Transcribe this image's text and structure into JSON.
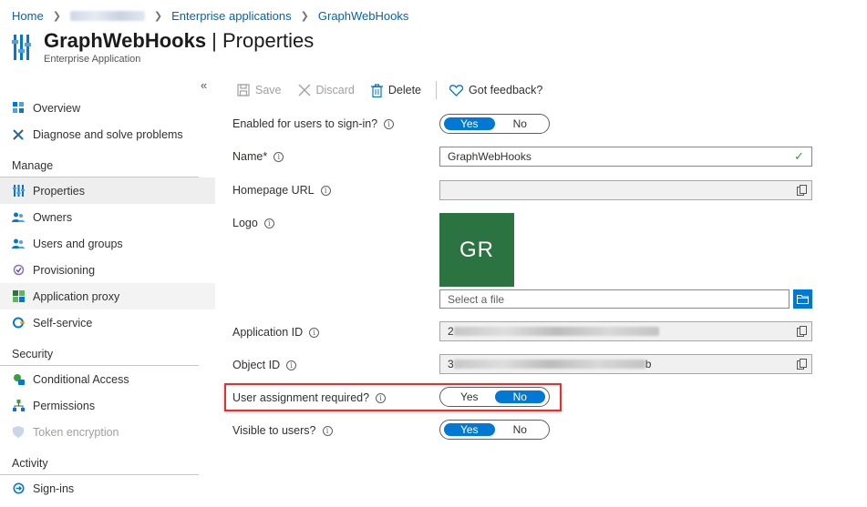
{
  "breadcrumb": {
    "home": "Home",
    "enterprise": "Enterprise applications",
    "app": "GraphWebHooks"
  },
  "header": {
    "title_bold": "GraphWebHooks",
    "title_rest": " | Properties",
    "subtitle": "Enterprise Application"
  },
  "sidebar": {
    "top_items": [
      {
        "label": "Overview",
        "icon": "overview-grid-icon"
      },
      {
        "label": "Diagnose and solve problems",
        "icon": "tools-icon"
      }
    ],
    "manage_header": "Manage",
    "manage_items": [
      {
        "label": "Properties",
        "icon": "properties-icon"
      },
      {
        "label": "Owners",
        "icon": "people-icon"
      },
      {
        "label": "Users and groups",
        "icon": "people-icon"
      },
      {
        "label": "Provisioning",
        "icon": "provisioning-icon"
      },
      {
        "label": "Application proxy",
        "icon": "app-proxy-icon"
      },
      {
        "label": "Self-service",
        "icon": "self-service-icon"
      }
    ],
    "security_header": "Security",
    "security_items": [
      {
        "label": "Conditional Access",
        "icon": "conditional-access-icon"
      },
      {
        "label": "Permissions",
        "icon": "permissions-icon"
      },
      {
        "label": "Token encryption",
        "icon": "shield-icon"
      }
    ],
    "activity_header": "Activity",
    "activity_items": [
      {
        "label": "Sign-ins",
        "icon": "sign-ins-icon"
      }
    ]
  },
  "toolbar": {
    "save": "Save",
    "discard": "Discard",
    "delete": "Delete",
    "feedback": "Got feedback?"
  },
  "form": {
    "enabled_label": "Enabled for users to sign-in?",
    "enabled_value": "Yes",
    "name_label": "Name",
    "name_required": " *",
    "name_value": "GraphWebHooks",
    "homepage_label": "Homepage URL",
    "homepage_value": "",
    "logo_label": "Logo",
    "logo_initials": "GR",
    "file_placeholder": "Select a file",
    "appid_label": "Application ID",
    "appid_prefix": "2",
    "objectid_label": "Object ID",
    "objectid_prefix": "3",
    "objectid_suffix": "b",
    "assignment_label": "User assignment required?",
    "assignment_value": "No",
    "visible_label": "Visible to users?",
    "visible_value": "Yes",
    "yes": "Yes",
    "no": "No"
  },
  "colors": {
    "accent": "#0078d4",
    "link": "#0064b4",
    "logo_bg": "#2b7340",
    "highlight": "#e03232"
  }
}
